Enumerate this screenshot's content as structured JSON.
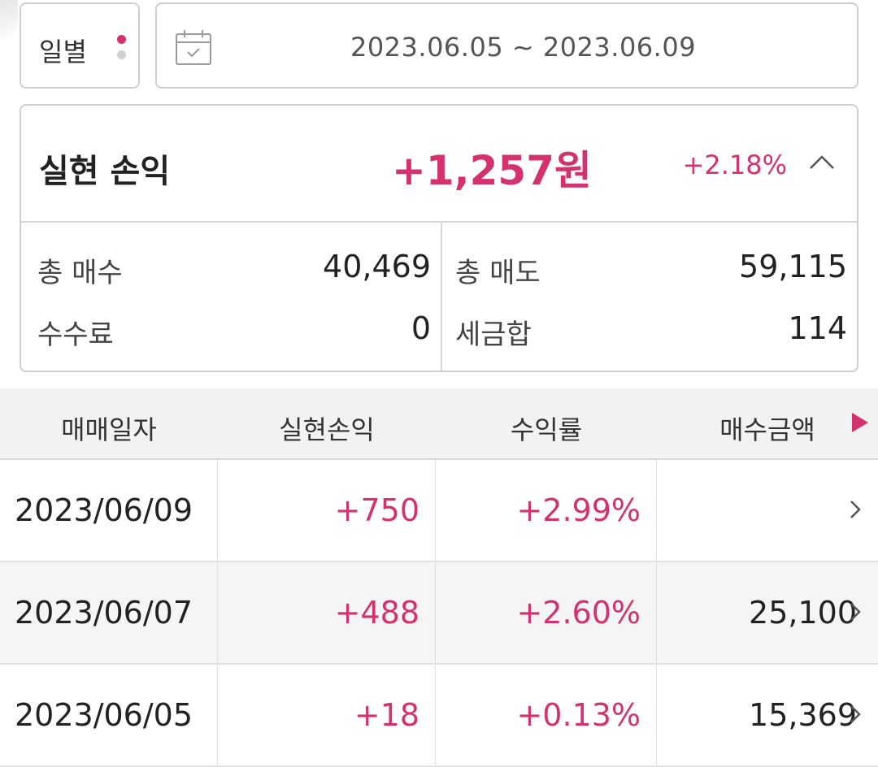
{
  "period": {
    "label": "일별"
  },
  "date_range": {
    "text": "2023.06.05 ~ 2023.06.09"
  },
  "summary": {
    "title": "실현 손익",
    "amount": "+1,257원",
    "rate": "+2.18%",
    "total_buy_label": "총 매수",
    "total_buy_value": "40,469",
    "total_sell_label": "총 매도",
    "total_sell_value": "59,115",
    "fee_label": "수수료",
    "fee_value": "0",
    "tax_label": "세금합",
    "tax_value": "114"
  },
  "table": {
    "headers": [
      "매매일자",
      "실현손익",
      "수익률",
      "매수금액"
    ],
    "rows": [
      {
        "date": "2023/06/09",
        "pl": "+750",
        "rate": "+2.99%",
        "buy": ""
      },
      {
        "date": "2023/06/07",
        "pl": "+488",
        "rate": "+2.60%",
        "buy": "25,100"
      },
      {
        "date": "2023/06/05",
        "pl": "+18",
        "rate": "+0.13%",
        "buy": "15,369"
      }
    ]
  },
  "colors": {
    "accent": "#d4326e",
    "border": "#cfcfcf",
    "header_bg": "#f2f2f2"
  },
  "icons": [
    "calendar-icon",
    "chevron-up-icon",
    "play-right-icon",
    "chevron-right-icon"
  ]
}
